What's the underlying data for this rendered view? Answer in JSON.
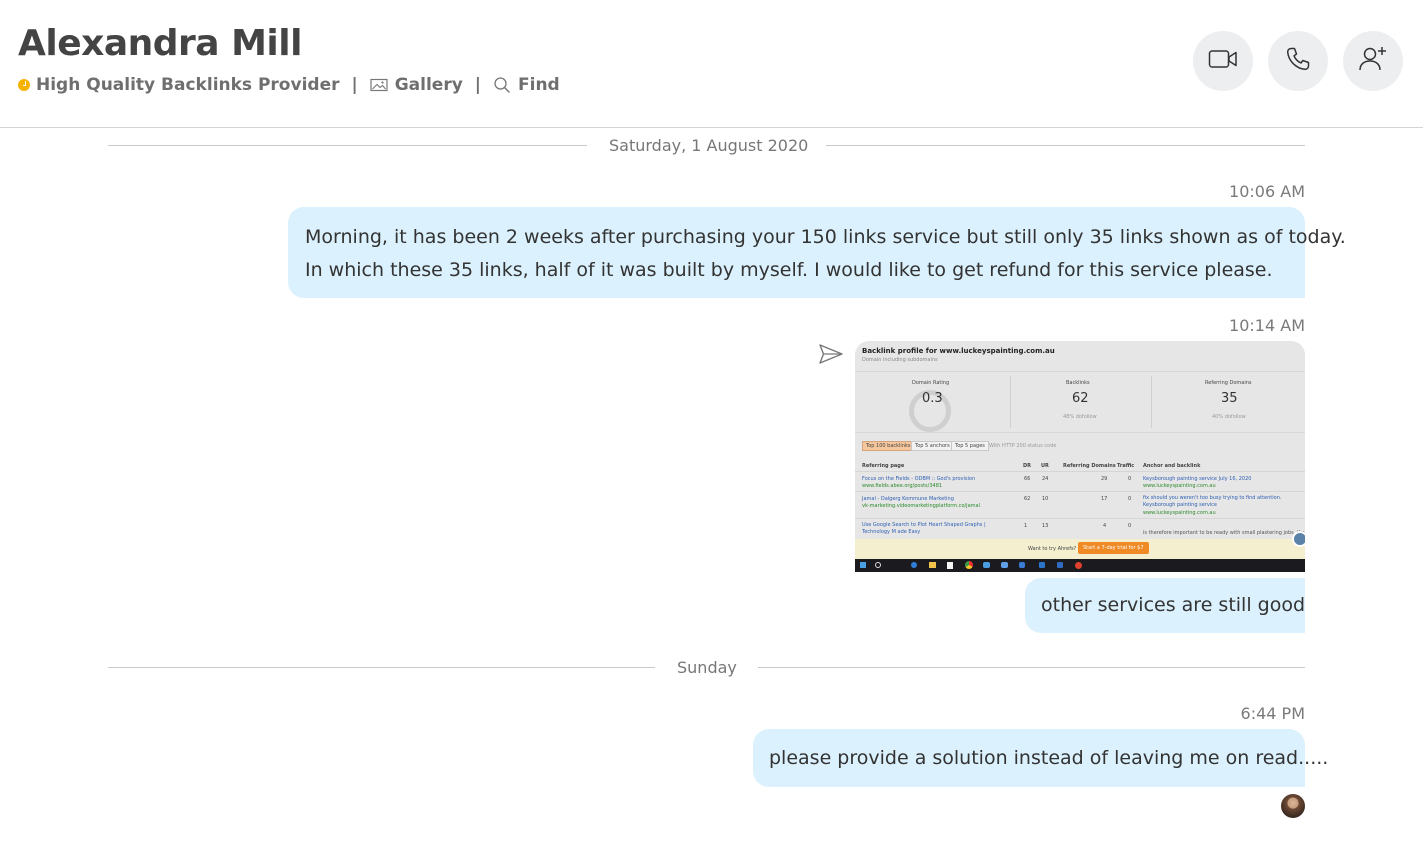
{
  "header": {
    "name": "Alexandra Mill",
    "status_text": "High Quality Backlinks Provider",
    "separator": "|",
    "gallery_label": "Gallery",
    "find_label": "Find",
    "status_color": "#f5b300",
    "icons": [
      "status-dot-icon",
      "gallery-icon",
      "search-icon",
      "video-call-icon",
      "phone-icon",
      "add-person-icon"
    ]
  },
  "conversation": {
    "day1": "Saturday, 1 August 2020",
    "msg1_time": "10:06 AM",
    "msg1_line1": "Morning, it has been 2 weeks after purchasing your 150 links service but still only 35 links shown as of today.",
    "msg1_line2": "In which these 35 links, half of it was built by myself. I would like to get refund for this service please.",
    "msg2_time": "10:14 AM",
    "msg3_text": "other services are still good",
    "day2": "Sunday",
    "msg4_time": "6:44 PM",
    "msg4_text": "please provide a solution instead of leaving me on read....."
  },
  "screenshot": {
    "title": "Backlink profile for www.luckeyspainting.com.au",
    "subtitle": "Domain including subdomains",
    "metric1_label": "Domain Rating",
    "metric1_value": "0.3",
    "metric2_label": "Backlinks",
    "metric2_value": "62",
    "metric2_sub": "48% dofollow",
    "metric3_label": "Referring Domains",
    "metric3_value": "35",
    "metric3_sub": "40% dofollow",
    "tab1": "Top 100 backlinks",
    "tab2": "Top 5 anchors",
    "tab3": "Top 5 pages",
    "tab_note": "With HTTP 200 status code",
    "col1": "Referring page",
    "col2": "DR",
    "col3": "UR",
    "col4": "Referring Domains",
    "col5": "Traffic",
    "col6": "Anchor and backlink",
    "rows": [
      {
        "page": "Focus on the Fields - ODBM :: God's provision",
        "url": "www.fields.abee.org/posts/3481",
        "dr": "66",
        "ur": "24",
        "rd": "29",
        "tr": "0",
        "anchor": "Keysborough painting service July 16, 2020",
        "link": "www.luckeyspainting.com.au"
      },
      {
        "page": "Jamal - Dalgerg Kommune Marketing",
        "url": "vk-marketing.videomarketingplatform.co/jamal",
        "dr": "62",
        "ur": "10",
        "rd": "17",
        "tr": "0",
        "anchor": "fix should you weren't too busy trying to find attention. Keysborough painting service",
        "link": "www.luckeyspainting.com.au"
      },
      {
        "page": "Use Google Search to Plot Heart Shaped Graphs | Technology M ade Easy",
        "url": "",
        "dr": "1",
        "ur": "13",
        "rd": "4",
        "tr": "0",
        "anchor": "is therefore important to be ready with small plastering jobs. Keysb",
        "link": ""
      }
    ],
    "promo_text": "Want to try Ahrefs?",
    "promo_button": "Start a 7-day trial for $7"
  }
}
